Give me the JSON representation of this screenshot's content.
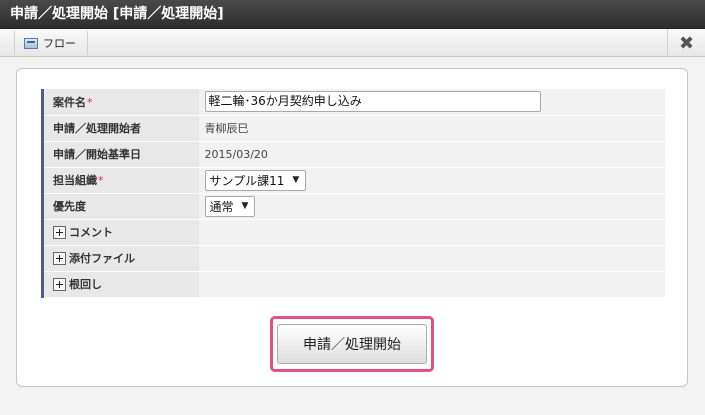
{
  "window": {
    "title": "申請／処理開始 [申請／処理開始]"
  },
  "toolbar": {
    "flow_tab_label": "フロー",
    "close_icon": "close-icon"
  },
  "form": {
    "subject": {
      "label": "案件名",
      "required_mark": "*",
      "value": "軽二輪･36か月契約申し込み"
    },
    "applicant": {
      "label": "申請／処理開始者",
      "value": "青柳辰巳"
    },
    "base_date": {
      "label": "申請／開始基準日",
      "value": "2015/03/20"
    },
    "organization": {
      "label": "担当組織",
      "required_mark": "*",
      "selected": "サンプル課11"
    },
    "priority": {
      "label": "優先度",
      "selected": "通常"
    },
    "comment": {
      "label": "コメント"
    },
    "attachment": {
      "label": "添付ファイル"
    },
    "nemawashi": {
      "label": "根回し"
    }
  },
  "actions": {
    "submit_label": "申請／処理開始"
  },
  "colors": {
    "highlight": "#e34f89",
    "label_accent": "#4a5e88",
    "required": "#e0245e"
  }
}
